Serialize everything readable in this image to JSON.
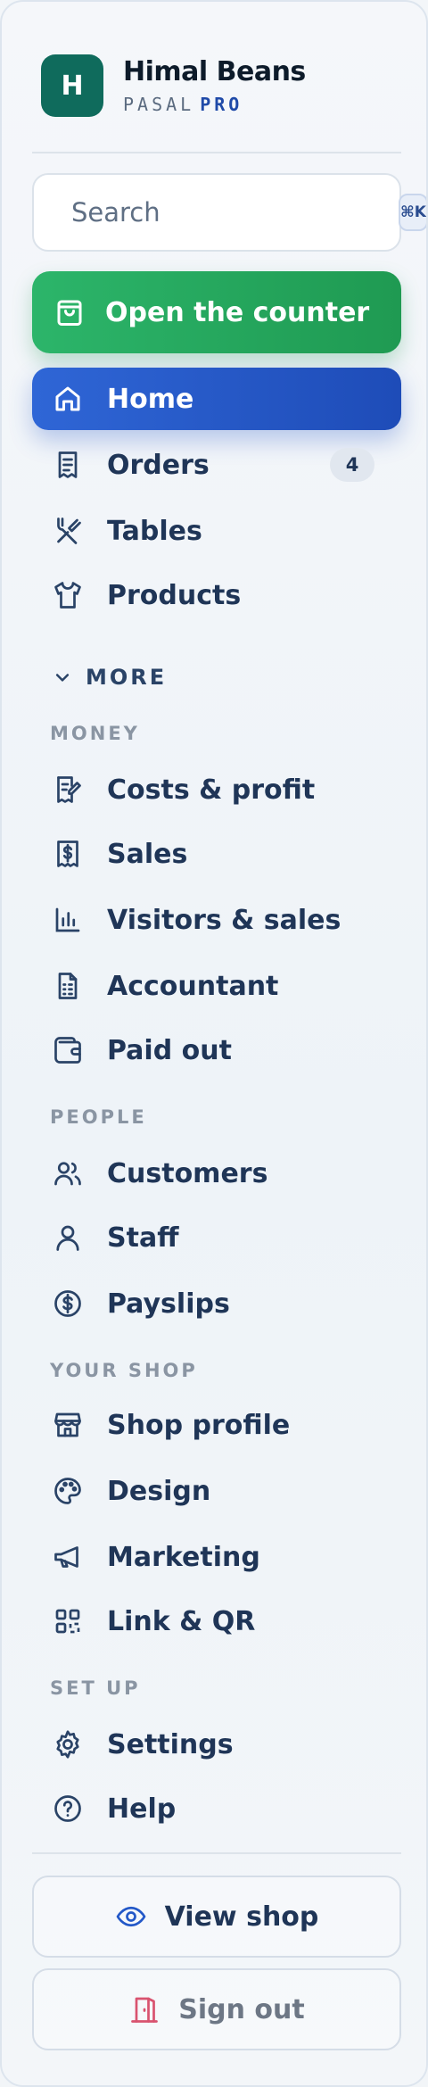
{
  "brand": {
    "logo_letter": "H",
    "name": "Himal Beans",
    "sub": "PASAL",
    "tier": "PRO"
  },
  "search": {
    "placeholder": "Search",
    "shortcut": "⌘K"
  },
  "counter_button": {
    "label": "Open the counter",
    "icon": "shopping-bag-icon",
    "color": "#22a55c"
  },
  "primary_nav": [
    {
      "label": "Home",
      "icon": "home-icon",
      "active": true
    },
    {
      "label": "Orders",
      "icon": "receipt-icon",
      "badge": "4"
    },
    {
      "label": "Tables",
      "icon": "utensils-icon"
    },
    {
      "label": "Products",
      "icon": "shirt-icon"
    }
  ],
  "more_label": "MORE",
  "sections": [
    {
      "title": "MONEY",
      "items": [
        {
          "label": "Costs & profit",
          "icon": "edit-receipt-icon"
        },
        {
          "label": "Sales",
          "icon": "dollar-receipt-icon"
        },
        {
          "label": "Visitors & sales",
          "icon": "bar-chart-icon"
        },
        {
          "label": "Accountant",
          "icon": "document-calculator-icon"
        },
        {
          "label": "Paid out",
          "icon": "wallet-icon"
        }
      ]
    },
    {
      "title": "PEOPLE",
      "items": [
        {
          "label": "Customers",
          "icon": "users-icon"
        },
        {
          "label": "Staff",
          "icon": "user-icon"
        },
        {
          "label": "Payslips",
          "icon": "dollar-circle-icon"
        }
      ]
    },
    {
      "title": "YOUR SHOP",
      "items": [
        {
          "label": "Shop profile",
          "icon": "store-icon"
        },
        {
          "label": "Design",
          "icon": "palette-icon"
        },
        {
          "label": "Marketing",
          "icon": "megaphone-icon"
        },
        {
          "label": "Link & QR",
          "icon": "qr-code-icon"
        }
      ]
    },
    {
      "title": "SET UP",
      "items": [
        {
          "label": "Settings",
          "icon": "gear-icon"
        },
        {
          "label": "Help",
          "icon": "help-circle-icon"
        }
      ]
    }
  ],
  "footer": {
    "view_shop": "View shop",
    "sign_out": "Sign out"
  },
  "colors": {
    "accent": "#2358c8",
    "text": "#1f3557",
    "brand": "#0f6b5c",
    "danger": "#d9536f"
  }
}
